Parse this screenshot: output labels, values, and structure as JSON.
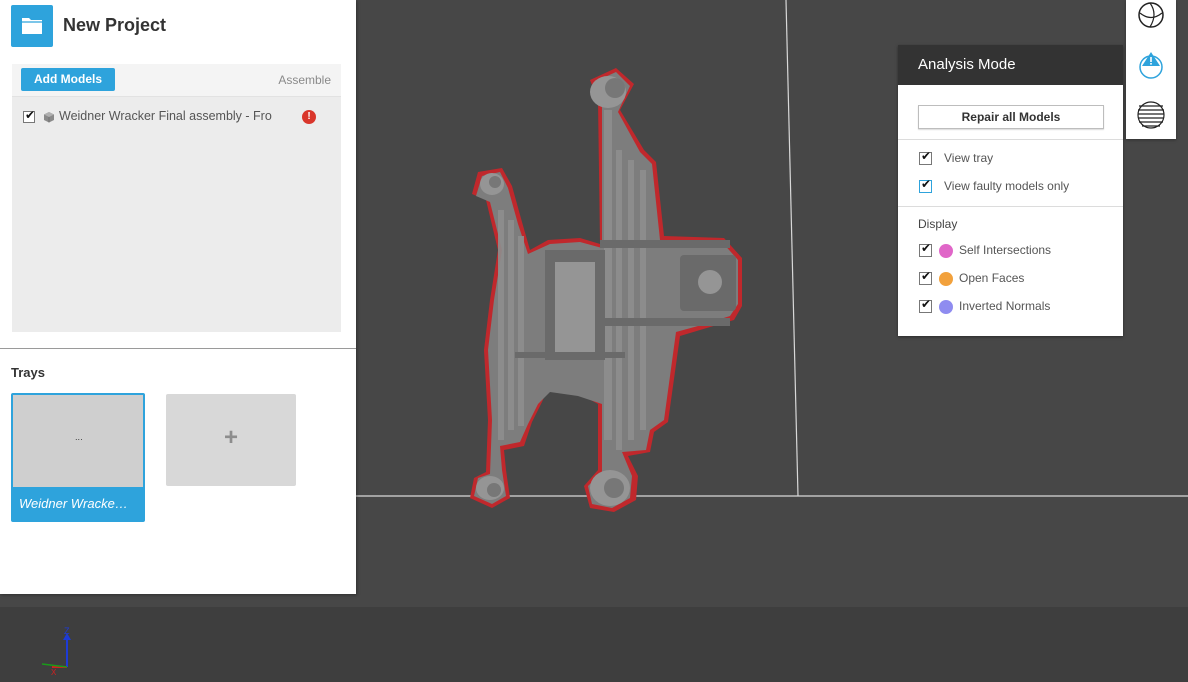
{
  "project": {
    "title": "New Project",
    "icon": "folder-icon"
  },
  "models": {
    "add_label": "Add Models",
    "assemble_label": "Assemble",
    "items": [
      {
        "name": "Weidner Wracker Final assembly - Fro",
        "checked": true,
        "icon": "cube-icon",
        "status_icon": "error-icon"
      }
    ]
  },
  "trays": {
    "label": "Trays",
    "items": [
      {
        "name": "Weidner Wracke…",
        "thumb_text": "..."
      }
    ],
    "add_symbol": "+"
  },
  "analysis": {
    "title": "Analysis Mode",
    "repair_label": "Repair all Models",
    "options": [
      {
        "label": "View tray",
        "checked": true
      },
      {
        "label": "View faulty models only",
        "checked": true
      }
    ],
    "display_label": "Display",
    "display_items": [
      {
        "label": "Self Intersections",
        "checked": true,
        "color": "#e066c8"
      },
      {
        "label": "Open Faces",
        "checked": true,
        "color": "#f2a13c"
      },
      {
        "label": "Inverted Normals",
        "checked": true,
        "color": "#8f8cf0"
      }
    ]
  },
  "tools": [
    {
      "icon": "sphere-view-icon"
    },
    {
      "icon": "analysis-warning-icon"
    },
    {
      "icon": "slice-layers-icon"
    }
  ],
  "axes": {
    "z": "Z",
    "x": "X"
  },
  "colors": {
    "accent": "#2ea3dc",
    "viewport": "#474747",
    "floor": "#3e3e3e",
    "panel_header": "#333333",
    "fault_outline": "#c0282c",
    "model_gray": "#7d7d7d"
  }
}
